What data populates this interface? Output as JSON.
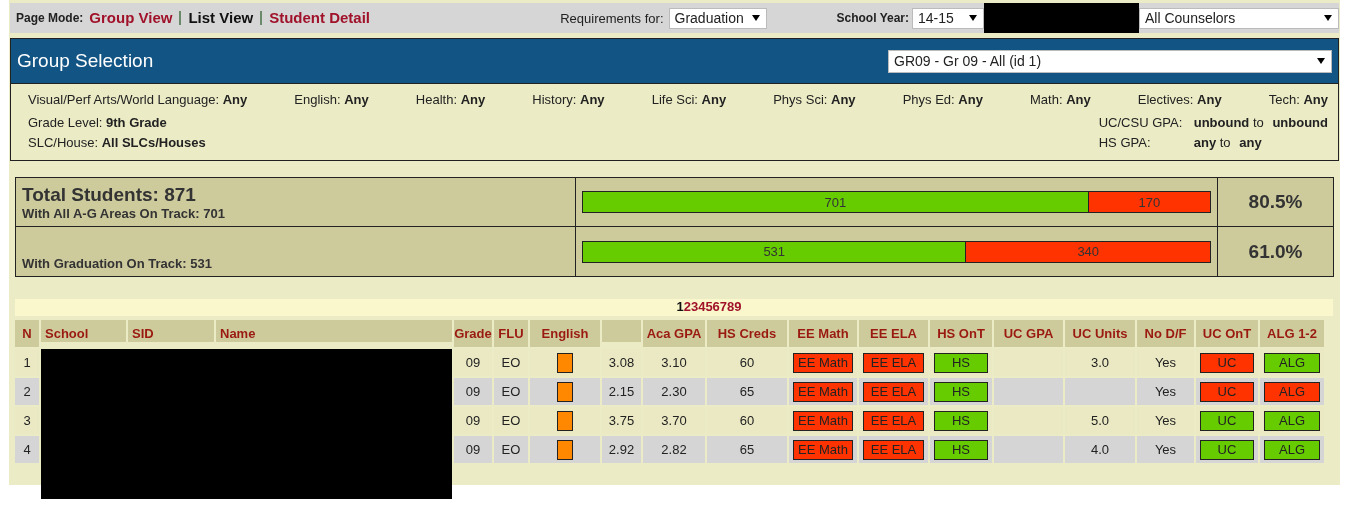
{
  "top_bar": {
    "page_mode_label": "Page Mode:",
    "modes": [
      {
        "label": "Group View",
        "selected": false
      },
      {
        "label": "List View",
        "selected": true
      },
      {
        "label": "Student Detail",
        "selected": false
      }
    ],
    "requirements_label": "Requirements for:",
    "requirements_value": "Graduation",
    "school_year_label": "School Year:",
    "school_year_value": "14-15",
    "counselor_value": "All Counselors"
  },
  "group_selection": {
    "title": "Group Selection",
    "group_value": "GR09 - Gr 09 - All (id 1)",
    "subject_filters": [
      {
        "label": "Visual/Perf Arts/World Language:",
        "value": "Any"
      },
      {
        "label": "English:",
        "value": "Any"
      },
      {
        "label": "Health:",
        "value": "Any"
      },
      {
        "label": "History:",
        "value": "Any"
      },
      {
        "label": "Life Sci:",
        "value": "Any"
      },
      {
        "label": "Phys Sci:",
        "value": "Any"
      },
      {
        "label": "Phys Ed:",
        "value": "Any"
      },
      {
        "label": "Math:",
        "value": "Any"
      },
      {
        "label": "Electives:",
        "value": "Any"
      },
      {
        "label": "Tech:",
        "value": "Any"
      }
    ],
    "left_filters": [
      {
        "label": "Grade Level:",
        "value": "9th Grade"
      },
      {
        "label": "SLC/House:",
        "value": "All SLCs/Houses"
      }
    ],
    "gpa_filters": [
      {
        "label": "UC/CSU GPA:",
        "min": "unbound",
        "sep": "to",
        "max": "unbound"
      },
      {
        "label": "HS GPA:",
        "min": "any",
        "sep": "to",
        "max": "any"
      }
    ]
  },
  "summary": [
    {
      "title": "Total Students: 871",
      "subtitle": "With All A-G Areas On Track: 701",
      "on_track": "701",
      "off_track": "170",
      "level": 0.805,
      "percent": "80.5%"
    },
    {
      "subtitle": "With Graduation On Track: 531",
      "on_track": "531",
      "off_track": "340",
      "level": 0.61,
      "percent": "61.0%"
    }
  ],
  "pages": [
    {
      "label": "1",
      "selected": true
    },
    {
      "label": "2",
      "selected": false
    },
    {
      "label": "3",
      "selected": false
    },
    {
      "label": "4",
      "selected": false
    },
    {
      "label": "5",
      "selected": false
    },
    {
      "label": "6",
      "selected": false
    },
    {
      "label": "7",
      "selected": false
    },
    {
      "label": "8",
      "selected": false
    },
    {
      "label": "9",
      "selected": false
    }
  ],
  "table": {
    "columns": [
      {
        "label": "N"
      },
      {
        "label": "School"
      },
      {
        "label": "SID"
      },
      {
        "label": "Name"
      },
      {
        "label": "Grade"
      },
      {
        "label": "FLU"
      },
      {
        "label": "English"
      },
      {},
      {
        "label": "Aca GPA"
      },
      {
        "label": "HS Creds"
      },
      {
        "label": "EE Math"
      },
      {
        "label": "EE ELA"
      },
      {
        "label": "HS OnT"
      },
      {
        "label": "UC GPA"
      },
      {
        "label": "UC Units"
      },
      {
        "label": "No D/F"
      },
      {
        "label": "UC OnT"
      },
      {
        "label": "ALG 1-2"
      }
    ],
    "rows": [
      {
        "n": "1",
        "grade": "09",
        "flu": "EO",
        "gpa": "3.08",
        "aca_gpa": "3.10",
        "hs_creds": "60",
        "ee_math": {
          "text": "EE Math",
          "ok": false
        },
        "ee_ela": {
          "text": "EE ELA",
          "ok": false
        },
        "hs_ont": {
          "text": "HS",
          "ok": true
        },
        "uc_units": "3.0",
        "no_df": "Yes",
        "uc_ont": {
          "text": "UC",
          "ok": false
        },
        "alg": {
          "text": "ALG",
          "ok": true
        }
      },
      {
        "n": "2",
        "grade": "09",
        "flu": "EO",
        "gpa": "2.15",
        "aca_gpa": "2.30",
        "hs_creds": "65",
        "ee_math": {
          "text": "EE Math",
          "ok": false
        },
        "ee_ela": {
          "text": "EE ELA",
          "ok": false
        },
        "hs_ont": {
          "text": "HS",
          "ok": true
        },
        "no_df": "Yes",
        "uc_ont": {
          "text": "UC",
          "ok": false
        },
        "alg": {
          "text": "ALG",
          "ok": false
        }
      },
      {
        "n": "3",
        "grade": "09",
        "flu": "EO",
        "gpa": "3.75",
        "aca_gpa": "3.70",
        "hs_creds": "60",
        "ee_math": {
          "text": "EE Math",
          "ok": false
        },
        "ee_ela": {
          "text": "EE ELA",
          "ok": false
        },
        "hs_ont": {
          "text": "HS",
          "ok": true
        },
        "uc_units": "5.0",
        "no_df": "Yes",
        "uc_ont": {
          "text": "UC",
          "ok": true
        },
        "alg": {
          "text": "ALG",
          "ok": true
        }
      },
      {
        "n": "4",
        "grade": "09",
        "flu": "EO",
        "gpa": "2.92",
        "aca_gpa": "2.82",
        "hs_creds": "65",
        "ee_math": {
          "text": "EE Math",
          "ok": false
        },
        "ee_ela": {
          "text": "EE ELA",
          "ok": false
        },
        "hs_ont": {
          "text": "HS",
          "ok": true
        },
        "uc_units": "4.0",
        "no_df": "Yes",
        "uc_ont": {
          "text": "UC",
          "ok": true
        },
        "alg": {
          "text": "ALG",
          "ok": true
        }
      }
    ]
  }
}
